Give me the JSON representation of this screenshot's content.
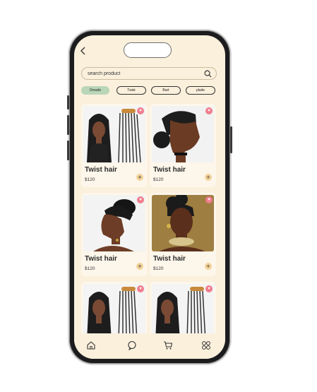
{
  "search": {
    "placeholder": "search product"
  },
  "filters": [
    "Dreads",
    "Twist",
    "Bart",
    "plaite"
  ],
  "products": [
    {
      "name": "Twist hair",
      "price": "$120",
      "image": "braids-long"
    },
    {
      "name": "Twist hair",
      "price": "$120",
      "image": "cornrows-bun-side"
    },
    {
      "name": "Twist hair",
      "price": "$120",
      "image": "braided-updo-profile"
    },
    {
      "name": "Twist hair",
      "price": "$120",
      "image": "updo-gold-necklace"
    },
    {
      "name": "",
      "price": "",
      "image": "braids-long"
    },
    {
      "name": "",
      "price": "",
      "image": "braids-long"
    }
  ],
  "icons": {
    "back": "chevron-left-icon",
    "search": "search-icon",
    "favorite": "heart-icon",
    "add": "plus-icon",
    "tabs": [
      "home-icon",
      "chat-icon",
      "cart-icon",
      "grid-icon"
    ]
  },
  "colors": {
    "background": "#fbf0dc",
    "active_chip": "#b9d6b8",
    "favorite": "#ef7d8e",
    "add": "#f3d39a"
  }
}
